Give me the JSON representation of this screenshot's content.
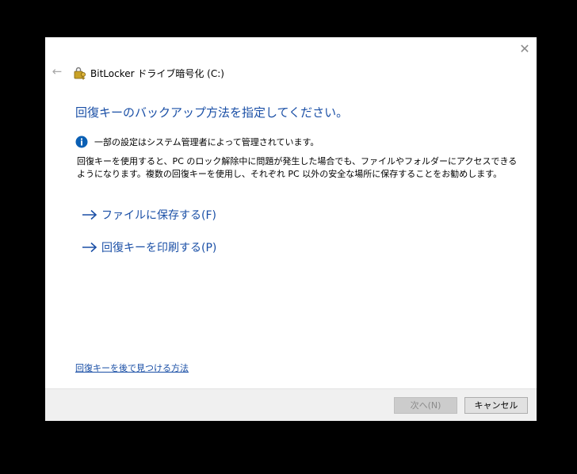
{
  "window": {
    "title": "BitLocker ドライブ暗号化 (C:)",
    "close_glyph": "✕",
    "back_glyph": "←"
  },
  "main": {
    "heading": "回復キーのバックアップ方法を指定してください。",
    "info_text": "一部の設定はシステム管理者によって管理されています。",
    "description": "回復キーを使用すると、PC のロック解除中に問題が発生した場合でも、ファイルやフォルダーにアクセスできるようになります。複数の回復キーを使用し、それぞれ PC 以外の安全な場所に保存することをお勧めします。",
    "options": [
      {
        "label": "ファイルに保存する(F)",
        "icon": "arrow-right-icon"
      },
      {
        "label": "回復キーを印刷する(P)",
        "icon": "arrow-right-icon"
      }
    ],
    "help_link": "回復キーを後で見つける方法"
  },
  "footer": {
    "next_label": "次へ(N)",
    "cancel_label": "キャンセル"
  },
  "colors": {
    "accent": "#1a4fa6",
    "info_blue": "#0a5fb4",
    "footer_bg": "#f0f0f0"
  }
}
